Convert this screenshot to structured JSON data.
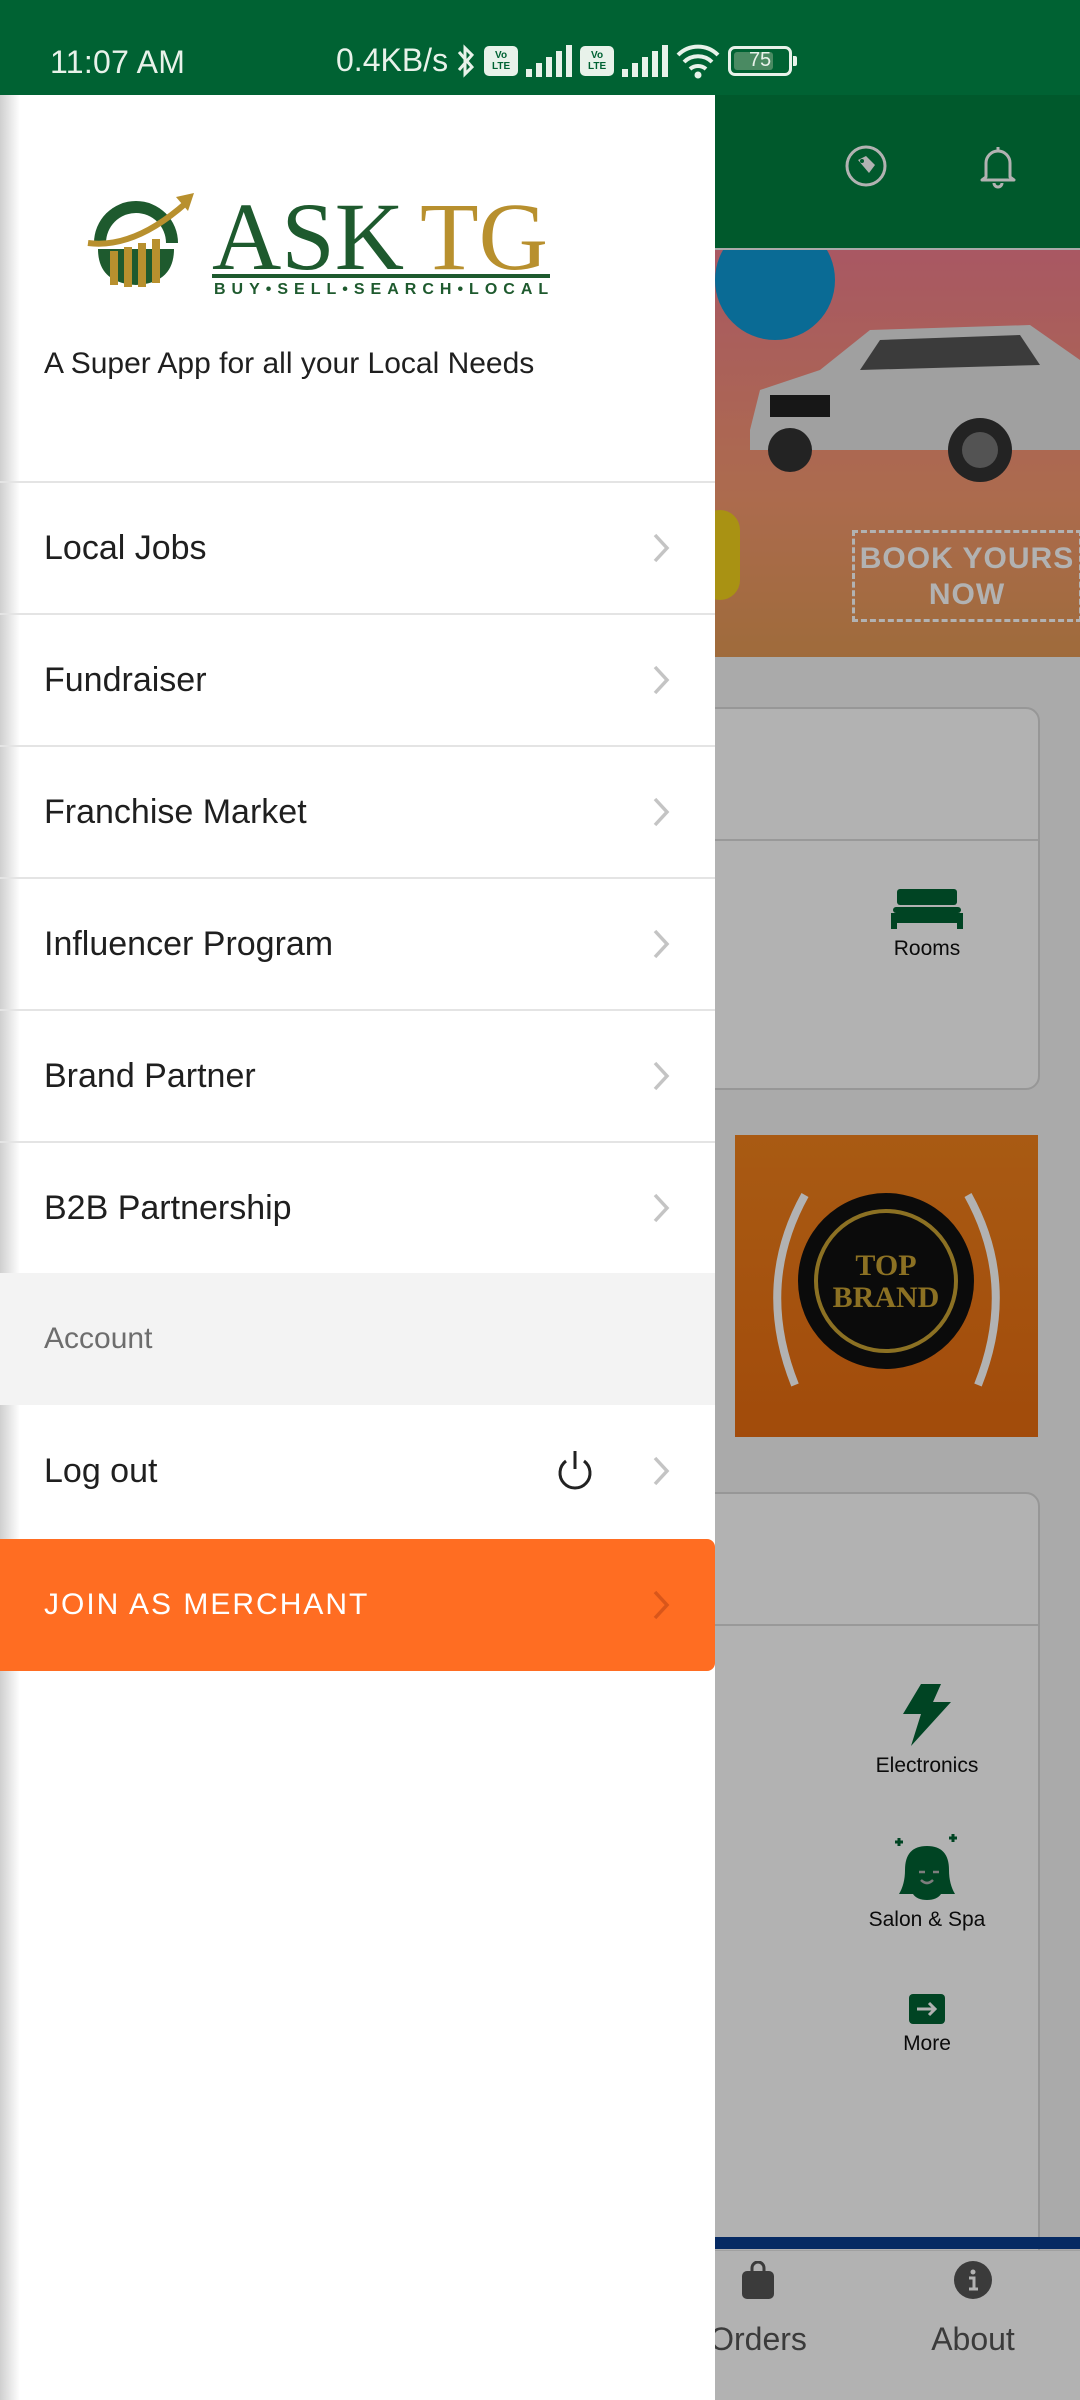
{
  "status_bar": {
    "time": "11:07 AM",
    "net_speed": "0.4KB/s",
    "volte_label_top": "Vo",
    "volte_label_bottom": "LTE",
    "battery_level": "75",
    "battery_fraction": 0.75,
    "icons": [
      "bluetooth-icon",
      "volte-icon",
      "signal-icon",
      "volte-icon",
      "signal-icon",
      "wifi-icon",
      "battery-icon"
    ]
  },
  "drawer": {
    "logo": {
      "brand_primary": "ASK",
      "brand_accent": "TG",
      "subtitle": "BUY•SELL•SEARCH•LOCAL"
    },
    "tagline": "A Super App for all your Local Needs",
    "menu_items": [
      {
        "label": "Local Jobs"
      },
      {
        "label": "Fundraiser"
      },
      {
        "label": "Franchise Market"
      },
      {
        "label": "Influencer Program"
      },
      {
        "label": "Brand Partner"
      },
      {
        "label": "B2B Partnership"
      }
    ],
    "account_section": "Account",
    "logout_label": "Log out",
    "merchant_button": "JOIN AS MERCHANT"
  },
  "background": {
    "banner_text_line1": "BOOK YOURS",
    "banner_text_line2": "NOW",
    "categories_card1": [
      {
        "label": "Rooms",
        "icon": "bed-icon"
      }
    ],
    "top_brand_text_line1": "TOP",
    "top_brand_text_line2": "BRAND",
    "categories_card2": [
      {
        "label": "Electronics",
        "icon": "lightning-icon"
      },
      {
        "label": "Salon & Spa",
        "icon": "salon-face-icon"
      },
      {
        "label": "More",
        "icon": "arrow-right-box-icon"
      }
    ],
    "bottom_nav": [
      {
        "label": "Orders",
        "icon": "shopping-bag-icon"
      },
      {
        "label": "About",
        "icon": "info-icon"
      }
    ]
  },
  "colors": {
    "brand_green": "#006233",
    "brand_gold": "#b8902e",
    "merchant_orange": "#ff6d22",
    "section_bg": "#f3f3f3"
  }
}
